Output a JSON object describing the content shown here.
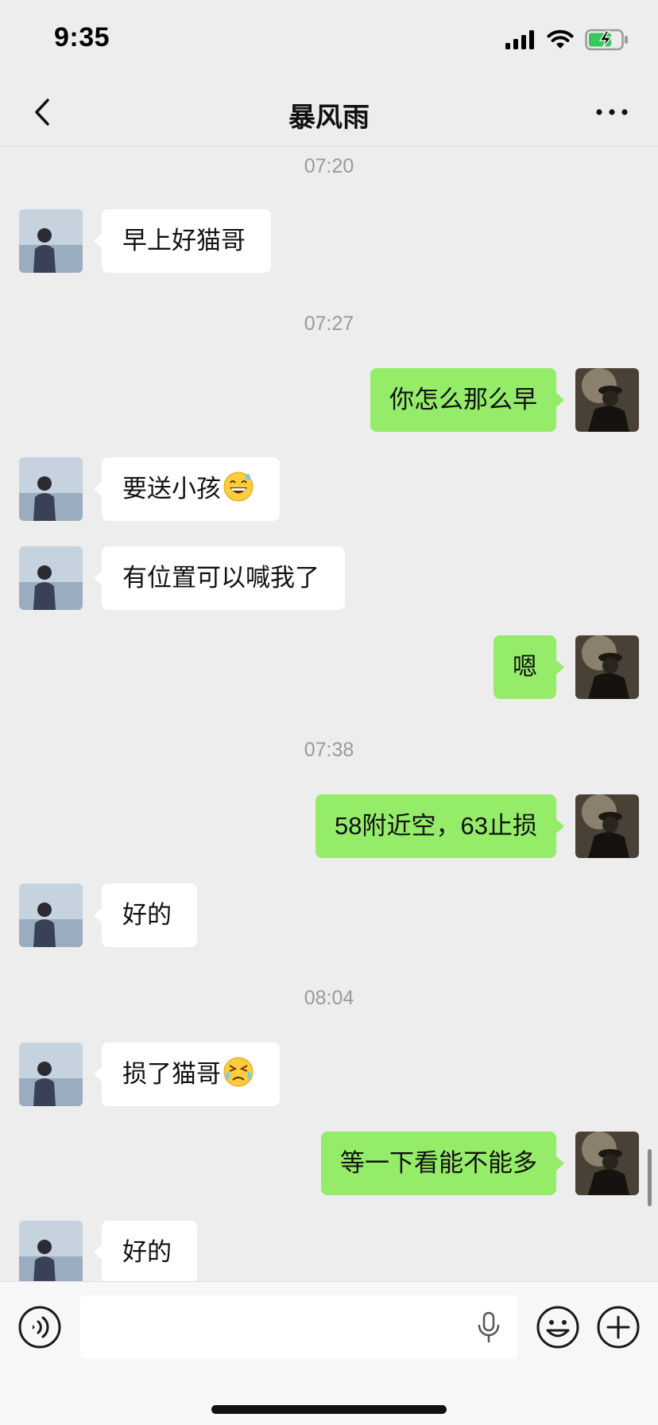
{
  "status_bar": {
    "time": "9:35"
  },
  "nav": {
    "title": "暴风雨"
  },
  "messages": [
    {
      "timestamp": "07:20"
    },
    {
      "side": "in",
      "text": "早上好猫哥"
    },
    {
      "timestamp": "07:27"
    },
    {
      "side": "out",
      "text": "你怎么那么早"
    },
    {
      "side": "in",
      "text": "要送小孩",
      "emoji": "grinning-sweat-emoji"
    },
    {
      "side": "in",
      "text": "有位置可以喊我了"
    },
    {
      "side": "out",
      "text": "嗯"
    },
    {
      "timestamp": "07:38"
    },
    {
      "side": "out",
      "text": "58附近空，63止损"
    },
    {
      "side": "in",
      "text": "好的"
    },
    {
      "timestamp": "08:04"
    },
    {
      "side": "in",
      "text": "损了猫哥",
      "emoji": "tearful-squint-emoji"
    },
    {
      "side": "out",
      "text": "等一下看能不能多"
    },
    {
      "side": "in",
      "text": "好的"
    }
  ],
  "input": {
    "value": "",
    "placeholder": ""
  },
  "icons": {
    "back": "chevron-left-icon",
    "more": "more-dots-icon",
    "voice": "voice-mode-icon",
    "mic": "microphone-icon",
    "emoji": "emoji-icon",
    "add": "plus-icon"
  },
  "colors": {
    "background": "#ededed",
    "outgoing_bubble": "#95ec69",
    "incoming_bubble": "#ffffff",
    "battery": "#34c759"
  }
}
